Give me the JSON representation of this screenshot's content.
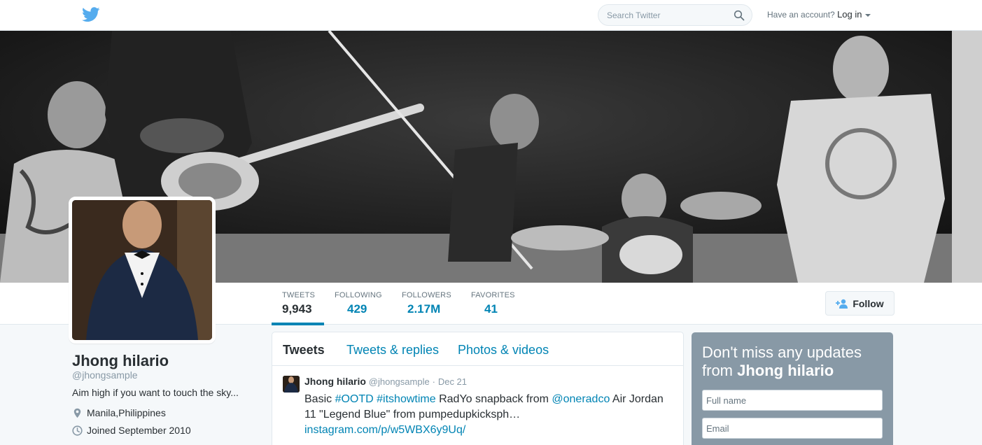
{
  "nav": {
    "search_placeholder": "Search Twitter",
    "have_account": "Have an account?",
    "login_label": "Log in"
  },
  "stats": [
    {
      "label": "TWEETS",
      "value": "9,943"
    },
    {
      "label": "FOLLOWING",
      "value": "429"
    },
    {
      "label": "FOLLOWERS",
      "value": "2.17M"
    },
    {
      "label": "FAVORITES",
      "value": "41"
    }
  ],
  "follow_label": "Follow",
  "profile": {
    "name": "Jhong hilario",
    "handle": "@jhongsample",
    "bio": "Aim high if you want to touch the sky...",
    "location": "Manila,Philippines",
    "joined": "Joined September 2010"
  },
  "timeline": {
    "tabs": [
      "Tweets",
      "Tweets & replies",
      "Photos & videos"
    ],
    "tweet": {
      "name": "Jhong hilario",
      "username": "@jhongsample",
      "separator": "·",
      "time": "Dec 21",
      "text_1": "Basic ",
      "hashtag_1": "#OOTD",
      "space_1": " ",
      "hashtag_2": "#itshowtime",
      "text_2": " RadYo snapback from ",
      "mention": "@oneradco",
      "text_3": " Air Jordan 11 \"Legend Blue\" from pumpedupkicksph…",
      "url": "instagram.com/p/w5WBX6y9Uq/"
    }
  },
  "signup": {
    "heading_prefix": "Don't miss any updates from ",
    "heading_name": "Jhong hilario",
    "fullname_placeholder": "Full name",
    "email_placeholder": "Email"
  },
  "colors": {
    "brand": "#55acee",
    "link": "#0084b4",
    "signup_bg": "#8899a6"
  },
  "icons": [
    "twitter-bird-icon",
    "search-icon",
    "caret-down-icon",
    "add-user-icon",
    "location-pin-icon",
    "calendar-icon"
  ]
}
